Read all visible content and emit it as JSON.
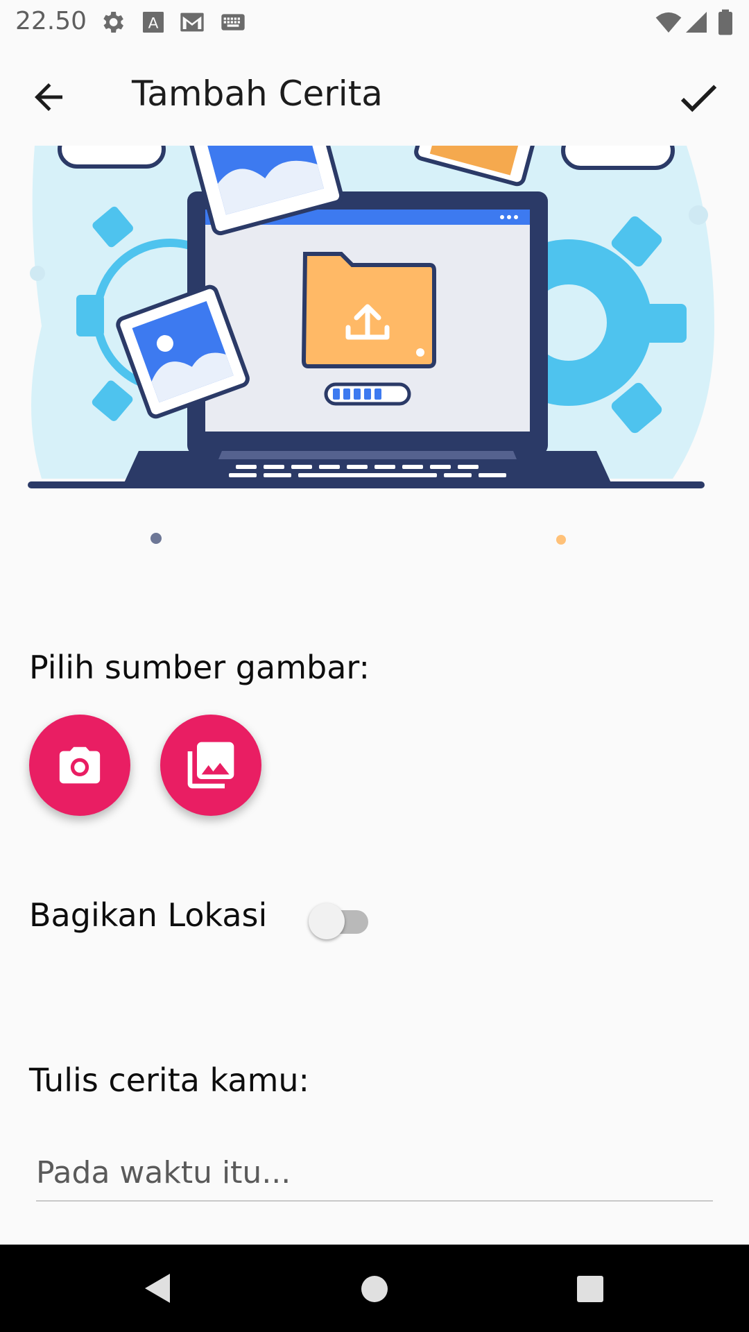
{
  "status_bar": {
    "time": "22.50",
    "icons": [
      "settings-icon",
      "a-box-icon",
      "gmail-icon",
      "keyboard-icon",
      "wifi-icon",
      "signal-icon",
      "battery-icon"
    ]
  },
  "app_bar": {
    "title": "Tambah Cerita",
    "back_icon": "arrow-back-icon",
    "confirm_icon": "check-icon"
  },
  "image_source": {
    "label": "Pilih sumber gambar:",
    "buttons": [
      "camera-icon",
      "gallery-icon"
    ]
  },
  "location": {
    "label": "Bagikan Lokasi",
    "enabled": false
  },
  "story": {
    "label": "Tulis cerita kamu:",
    "value": "",
    "placeholder": "Pada waktu itu..."
  },
  "nav_bar": {
    "icons": [
      "back-triangle-icon",
      "home-circle-icon",
      "recents-square-icon"
    ]
  },
  "colors": {
    "accent": "#e91e63",
    "background": "#fafafa"
  }
}
